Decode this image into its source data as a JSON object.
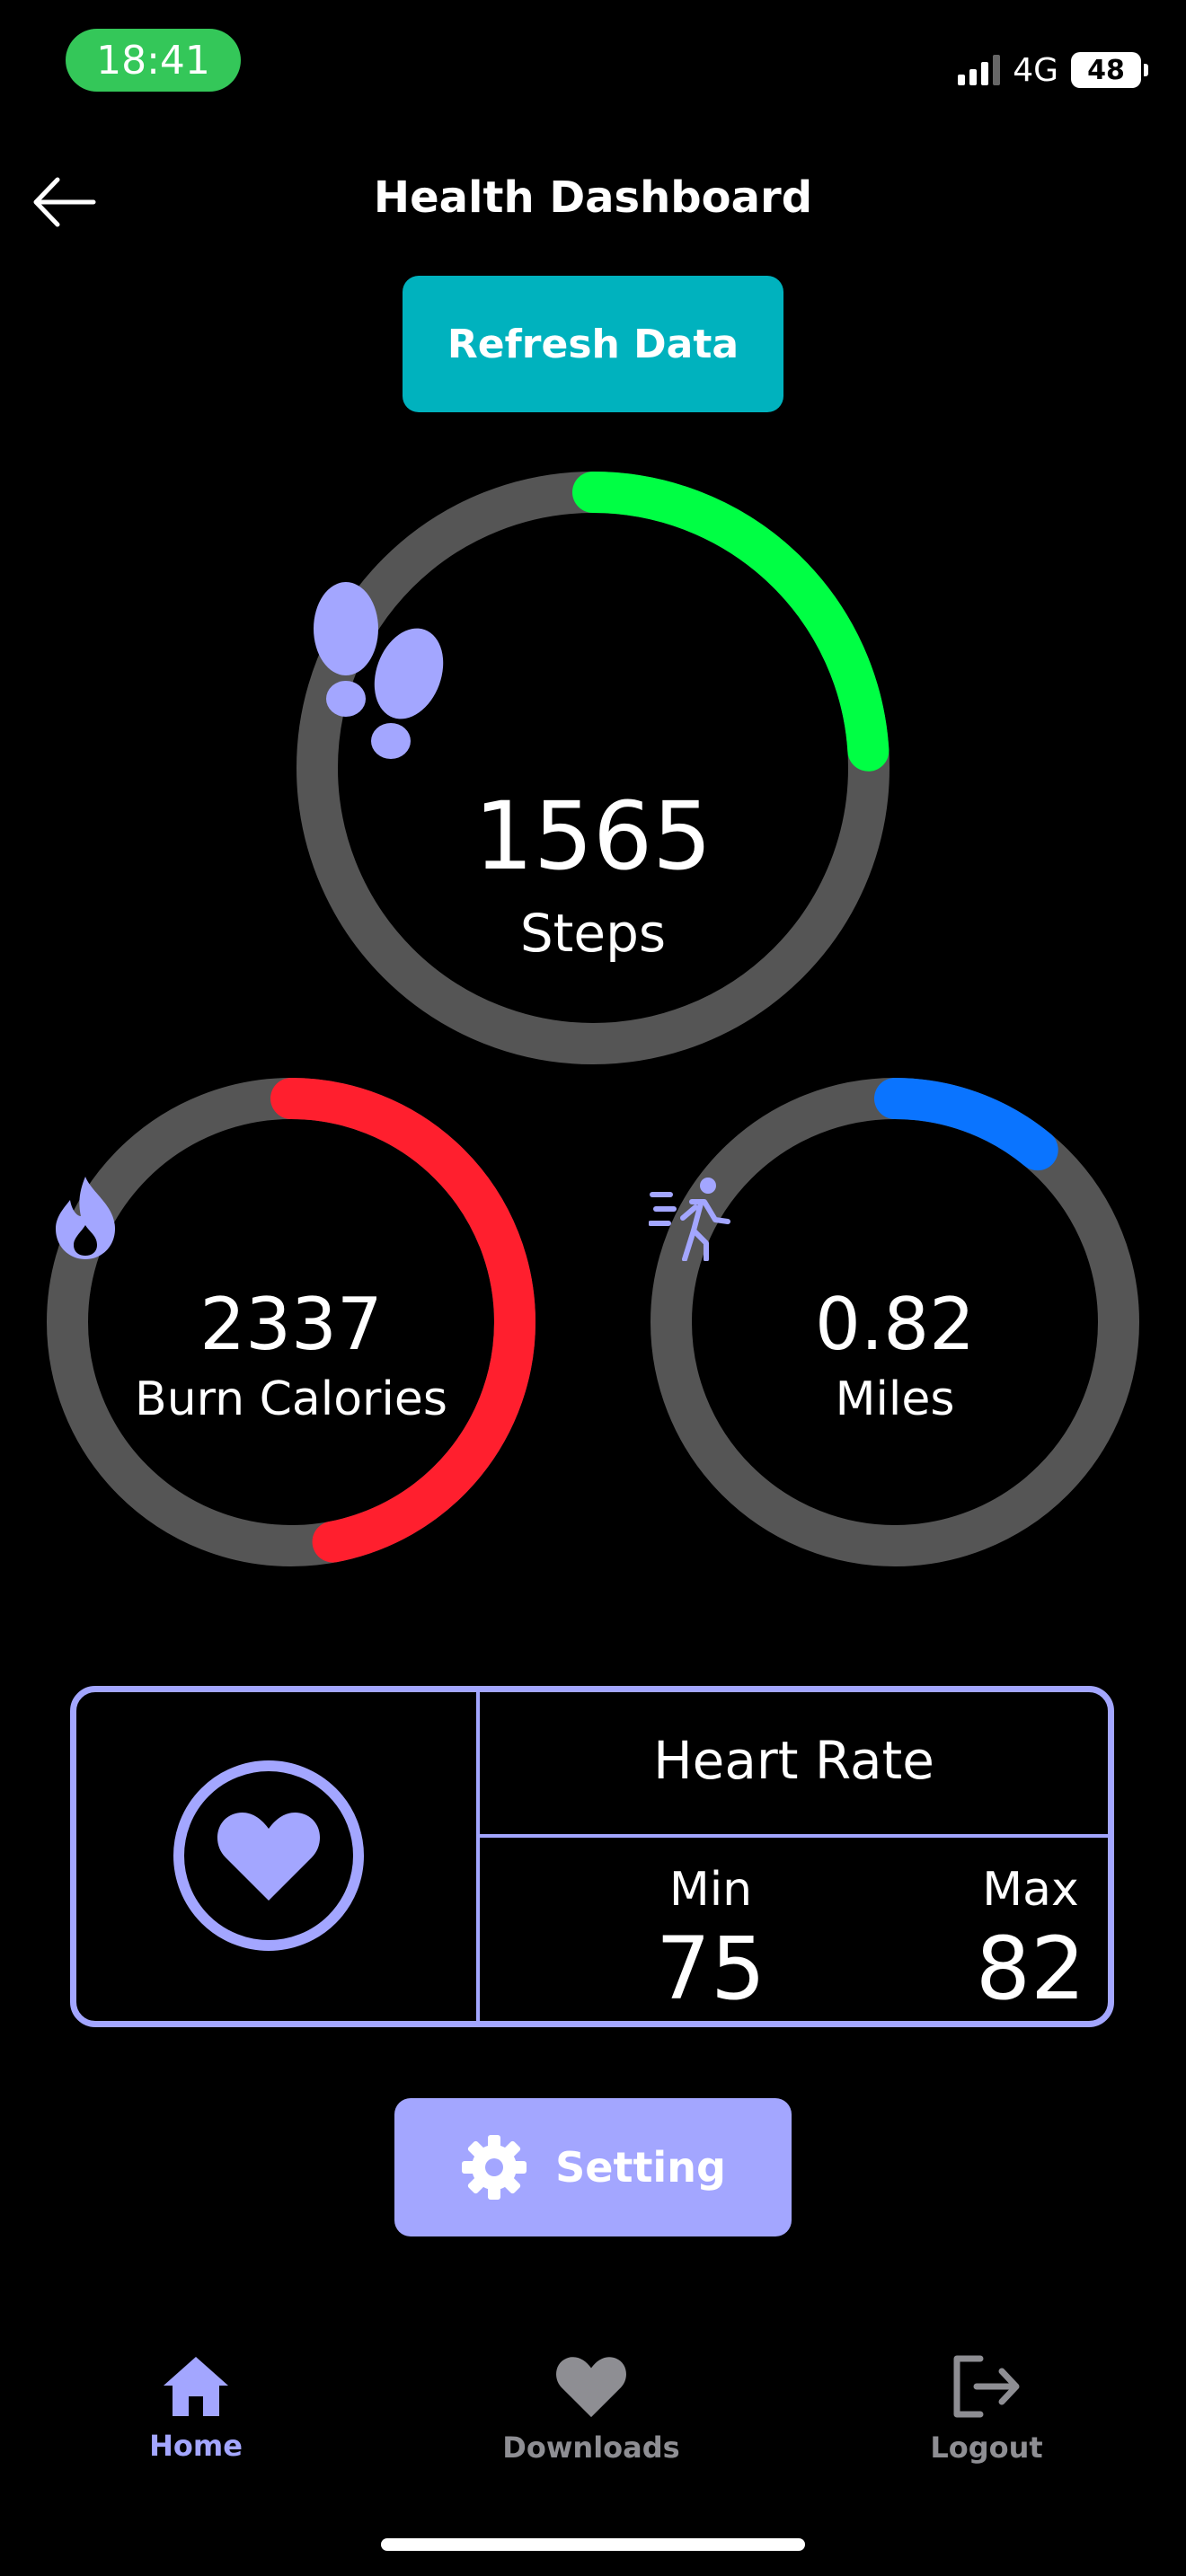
{
  "status": {
    "time": "18:41",
    "network": "4G",
    "battery": "48"
  },
  "header": {
    "title": "Health Dashboard",
    "refresh_label": "Refresh Data"
  },
  "steps": {
    "value": "1565",
    "label": "Steps",
    "progress": 0.24,
    "color": "#00ff44"
  },
  "calories": {
    "value": "2337",
    "label": "Burn Calories",
    "progress": 0.47,
    "color": "#ff1f2e"
  },
  "miles": {
    "value": "0.82",
    "label": "Miles",
    "progress": 0.11,
    "color": "#0a74ff"
  },
  "heart_rate": {
    "title": "Heart  Rate",
    "min_label": "Min",
    "min_value": "75",
    "max_label": "Max",
    "max_value": "82"
  },
  "setting_label": "Setting",
  "tabs": [
    {
      "label": "Home",
      "icon": "home-icon",
      "active": true
    },
    {
      "label": "Downloads",
      "icon": "heart-icon",
      "active": false
    },
    {
      "label": "Logout",
      "icon": "logout-icon",
      "active": false
    }
  ],
  "colors": {
    "accent": "#a3a6ff",
    "track": "#555555",
    "refresh": "#00b2be",
    "inactive": "#8e8e93"
  }
}
